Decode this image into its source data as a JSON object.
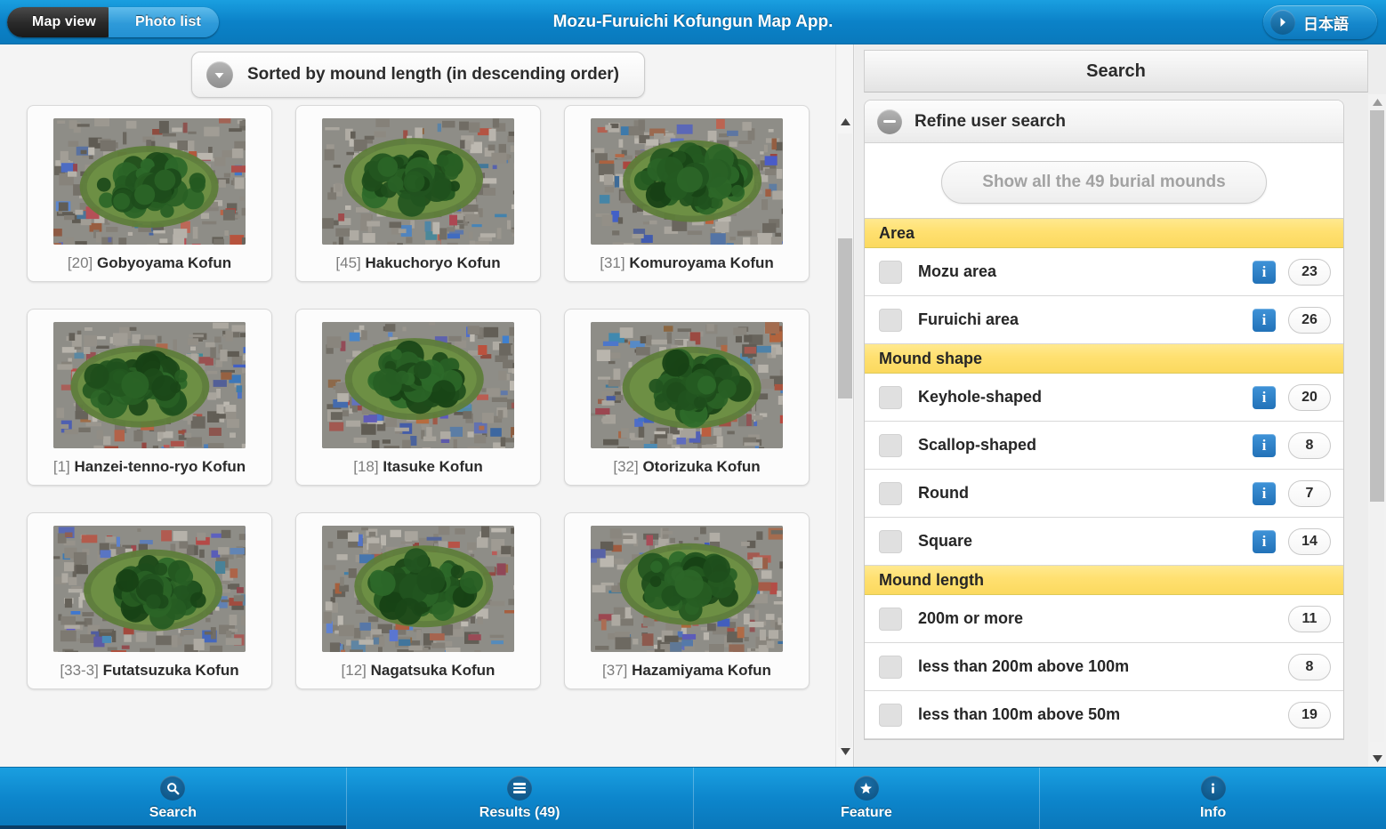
{
  "header": {
    "title": "Mozu-Furuichi Kofungun Map App.",
    "tabs": [
      {
        "label": "Map view",
        "active": true
      },
      {
        "label": "Photo list",
        "active": false
      }
    ],
    "language_button": {
      "label": "日本語",
      "icon": "chevron-right-circle-icon"
    }
  },
  "left": {
    "sort_bar": {
      "label": "Sorted by mound length (in descending order)",
      "icon": "chevron-down-circle-icon"
    },
    "cards": [
      {
        "index": "[20]",
        "name": "Gobyoyama Kofun"
      },
      {
        "index": "[45]",
        "name": "Hakuchoryo Kofun"
      },
      {
        "index": "[31]",
        "name": "Komuroyama Kofun"
      },
      {
        "index": "[1]",
        "name": "Hanzei-tenno-ryo Kofun"
      },
      {
        "index": "[18]",
        "name": "Itasuke Kofun"
      },
      {
        "index": "[32]",
        "name": "Otorizuka Kofun"
      },
      {
        "index": "[33-3]",
        "name": "Futatsuzuka Kofun"
      },
      {
        "index": "[12]",
        "name": "Nagatsuka Kofun"
      },
      {
        "index": "[37]",
        "name": "Hazamiyama Kofun"
      }
    ]
  },
  "right": {
    "panel_title": "Search",
    "refine": {
      "title": "Refine user search",
      "icon": "minus-circle-icon",
      "show_all_label": "Show all the 49 burial mounds"
    },
    "groups": [
      {
        "title": "Area",
        "rows": [
          {
            "label": "Mozu area",
            "count": "23",
            "has_info": true
          },
          {
            "label": "Furuichi area",
            "count": "26",
            "has_info": true
          }
        ]
      },
      {
        "title": "Mound shape",
        "rows": [
          {
            "label": "Keyhole-shaped",
            "count": "20",
            "has_info": true
          },
          {
            "label": "Scallop-shaped",
            "count": "8",
            "has_info": true
          },
          {
            "label": "Round",
            "count": "7",
            "has_info": true
          },
          {
            "label": "Square",
            "count": "14",
            "has_info": true
          }
        ]
      },
      {
        "title": "Mound length",
        "rows": [
          {
            "label": "200m or more",
            "count": "11",
            "has_info": false
          },
          {
            "label": "less than 200m above 100m",
            "count": "8",
            "has_info": false
          },
          {
            "label": "less than 100m above 50m",
            "count": "19",
            "has_info": false
          }
        ]
      }
    ]
  },
  "bottom_nav": [
    {
      "label": "Search",
      "icon": "magnifier-icon",
      "active": true
    },
    {
      "label": "Results (49)",
      "icon": "list-icon",
      "active": false
    },
    {
      "label": "Feature",
      "icon": "star-icon",
      "active": false
    },
    {
      "label": "Info",
      "icon": "info-icon",
      "active": false
    }
  ],
  "colors": {
    "header_blue": "#0b82c8",
    "group_yellow": "#ffe070",
    "info_blue": "#2272b8",
    "active_tab_dark": "#2b2b2b"
  }
}
